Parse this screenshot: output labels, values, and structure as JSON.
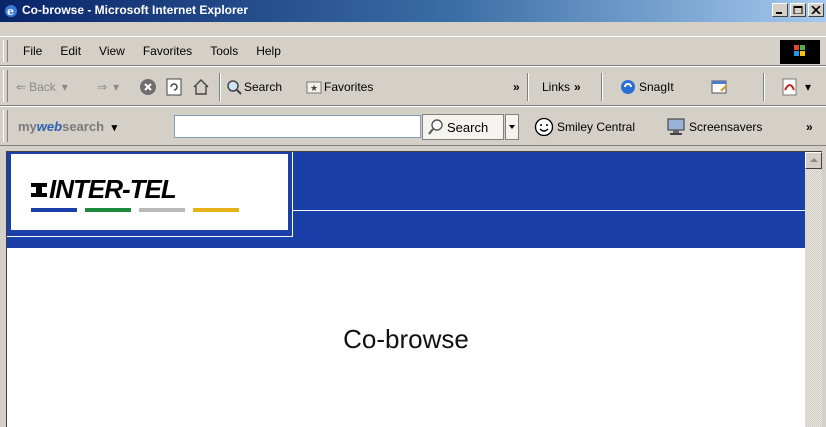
{
  "window": {
    "title": "Co-browse - Microsoft Internet Explorer",
    "buttons": [
      "minimize-button",
      "maximize-button",
      "close-button"
    ]
  },
  "menubar": {
    "items": [
      "File",
      "Edit",
      "View",
      "Favorites",
      "Tools",
      "Help"
    ]
  },
  "toolbar": {
    "back_label": "Back",
    "search_label": "Search",
    "favorites_label": "Favorites",
    "links_label": "Links",
    "snagit_label": "SnagIt",
    "overflow": "»"
  },
  "searchbar": {
    "logo_prefix": "my",
    "logo_web": "web",
    "logo_suffix": "search",
    "input_value": "",
    "search_button": "Search",
    "smiley_label": "Smiley Central",
    "screensavers_label": "Screensavers",
    "overflow": "»"
  },
  "page": {
    "logo_text": "INTER-TEL",
    "logo_colors": [
      "#1a3fa8",
      "#1e8a3e",
      "#b9b9b9",
      "#e5b21a"
    ],
    "title": "Co-browse"
  },
  "colors": {
    "banner": "#1a3fa8",
    "titlebar_start": "#0a246a"
  }
}
